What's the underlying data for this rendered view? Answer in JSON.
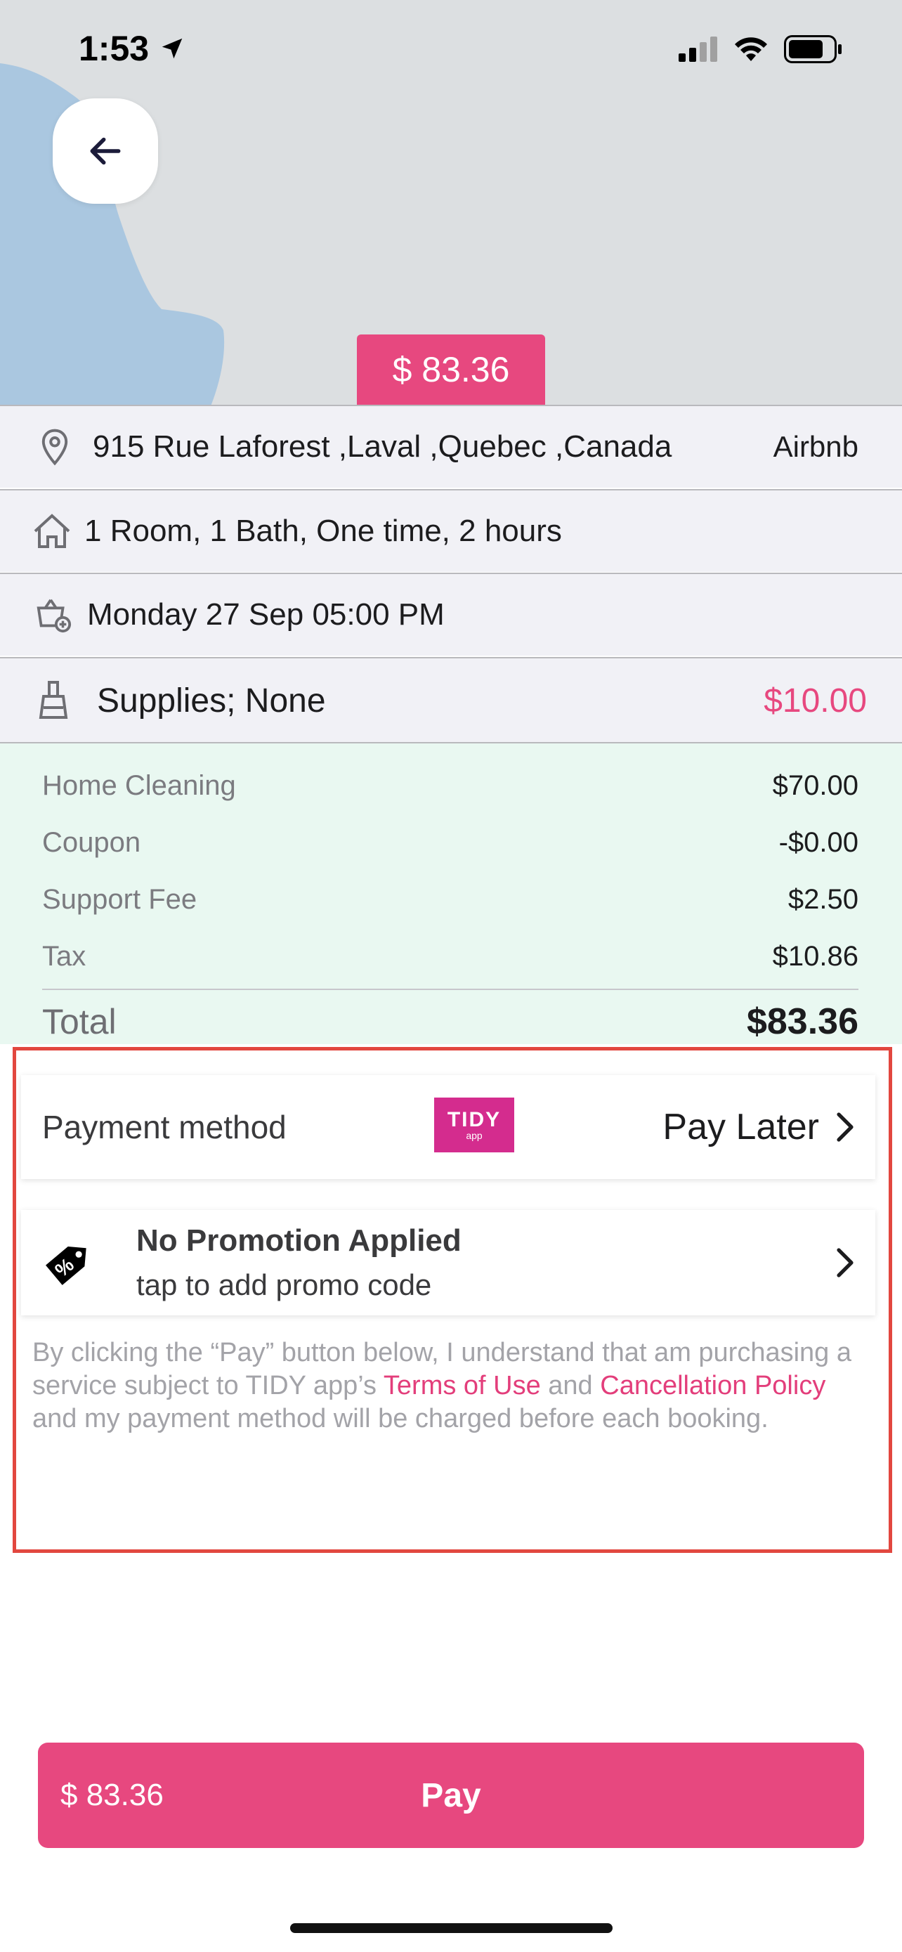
{
  "status_bar": {
    "time": "1:53"
  },
  "map": {
    "price_tag": "$ 83.36"
  },
  "booking": {
    "address": "915 Rue Laforest ,Laval ,Quebec ,Canada",
    "property_type": "Airbnb",
    "rooms": "1 Room, 1 Bath, One time, 2 hours",
    "datetime": "Monday 27  Sep 05:00 PM",
    "supplies_label": "Supplies; None",
    "supplies_price": "$10.00"
  },
  "breakdown": {
    "items": [
      {
        "label": "Home Cleaning",
        "value": "$70.00"
      },
      {
        "label": "Coupon",
        "value": "-$0.00"
      },
      {
        "label": "Support Fee",
        "value": "$2.50"
      },
      {
        "label": "Tax",
        "value": "$10.86"
      }
    ],
    "total_label": "Total",
    "total_value": "$83.36"
  },
  "payment": {
    "label": "Payment method",
    "logo_text": "TIDY",
    "logo_subtext": "app",
    "method": "Pay Later"
  },
  "promotion": {
    "title": "No Promotion Applied",
    "subtitle": "tap to add promo code"
  },
  "disclaimer": {
    "part1": "By clicking the “Pay” button below, I understand that am purchasing a service subject to TIDY app’s ",
    "terms_link": "Terms of Use",
    "part2": " and ",
    "cancel_link": "Cancellation Policy",
    "part3": " and my payment method will be charged before each booking."
  },
  "pay_button": {
    "amount": "$ 83.36",
    "label": "Pay"
  },
  "colors": {
    "accent": "#e7487f",
    "breakdown_bg": "#e9f8f1",
    "highlight": "#e2473f"
  }
}
